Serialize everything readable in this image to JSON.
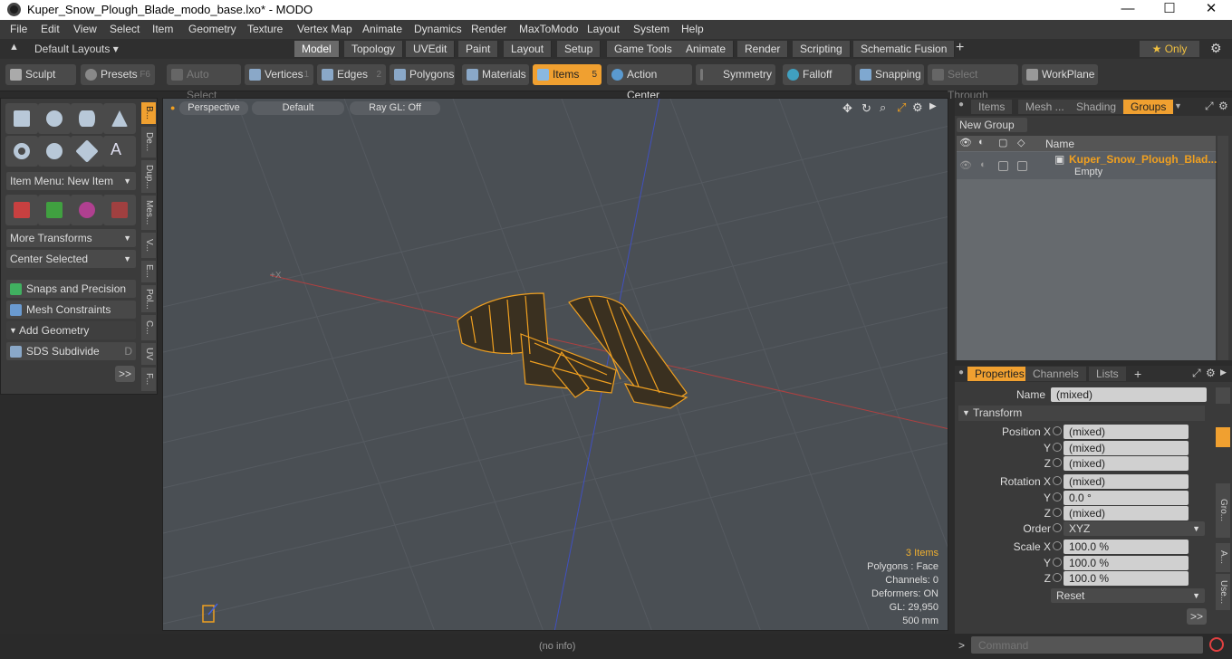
{
  "window": {
    "title": "Kuper_Snow_Plough_Blade_modo_base.lxo* - MODO",
    "min": "—",
    "max": "☐",
    "close": "✕"
  },
  "menu": [
    "File",
    "Edit",
    "View",
    "Select",
    "Item",
    "Geometry",
    "Texture",
    "Vertex Map",
    "Animate",
    "Dynamics",
    "Render",
    "MaxToModo",
    "Layout",
    "System",
    "Help"
  ],
  "layouts": {
    "label": "Default Layouts ▾",
    "tabs": [
      "Model",
      "Topology",
      "UVEdit",
      "Paint",
      "Layout",
      "Setup",
      "Game Tools",
      "Animate",
      "Render",
      "Scripting",
      "Schematic Fusion"
    ],
    "add": "+",
    "only": "★  Only",
    "gear": "⚙"
  },
  "toolbar": {
    "sculpt": "Sculpt",
    "presets": "Presets",
    "presets_key": "F6",
    "auto_select": "Auto Select",
    "vertices": "Vertices",
    "vertices_n": "1",
    "edges": "Edges",
    "edges_n": "2",
    "polygons": "Polygons",
    "materials": "Materials",
    "items": "Items",
    "items_n": "5",
    "action_center": "Action Center",
    "symmetry": "Symmetry",
    "falloff": "Falloff",
    "snapping": "Snapping",
    "select_through": "Select Through",
    "workplane": "WorkPlane"
  },
  "left": {
    "item_menu": "Item Menu: New Item",
    "more_transforms": "More Transforms",
    "center_selected": "Center Selected",
    "snaps": "Snaps and Precision",
    "mesh_constraints": "Mesh Constraints",
    "add_geometry": "Add Geometry",
    "sds": "SDS Subdivide",
    "sds_key": "D",
    "more": ">>",
    "vtabs": [
      "B...",
      "De...",
      "Dup...",
      "Mes...",
      "V...",
      "E...",
      "Pol...",
      "C...",
      "UV",
      "F..."
    ]
  },
  "viewport": {
    "perspective": "Perspective",
    "default": "Default",
    "raygl": "Ray GL: Off",
    "axis_x": "+X",
    "info": {
      "items": "3 Items",
      "polygons": "Polygons : Face",
      "channels": "Channels: 0",
      "deformers": "Deformers: ON",
      "gl": "GL: 29,950",
      "size": "500 mm"
    }
  },
  "groups": {
    "tabs": [
      "Items",
      "Mesh ...",
      "Shading",
      "Groups"
    ],
    "new_group": "New Group",
    "col_name": "Name",
    "row_name": "Kuper_Snow_Plough_Blad...",
    "row_sub": "Empty"
  },
  "properties": {
    "tabs": [
      "Properties",
      "Channels",
      "Lists"
    ],
    "add": "+",
    "name_label": "Name",
    "name_value": "(mixed)",
    "transform": "Transform",
    "rows": [
      {
        "label": "Position X",
        "value": "(mixed)"
      },
      {
        "label": "Y",
        "value": "(mixed)"
      },
      {
        "label": "Z",
        "value": "(mixed)"
      },
      {
        "label": "Rotation X",
        "value": "(mixed)"
      },
      {
        "label": "Y",
        "value": "0.0 °"
      },
      {
        "label": "Z",
        "value": "(mixed)"
      },
      {
        "label": "Order",
        "value": "XYZ"
      },
      {
        "label": "Scale X",
        "value": "100.0 %"
      },
      {
        "label": "Y",
        "value": "100.0 %"
      },
      {
        "label": "Z",
        "value": "100.0 %"
      }
    ],
    "reset": "Reset",
    "more": ">>",
    "side_tabs": [
      "Gro...",
      "A...",
      "Use..."
    ]
  },
  "status": {
    "info": "(no info)",
    "command_placeholder": "Command",
    "prompt": ">"
  }
}
